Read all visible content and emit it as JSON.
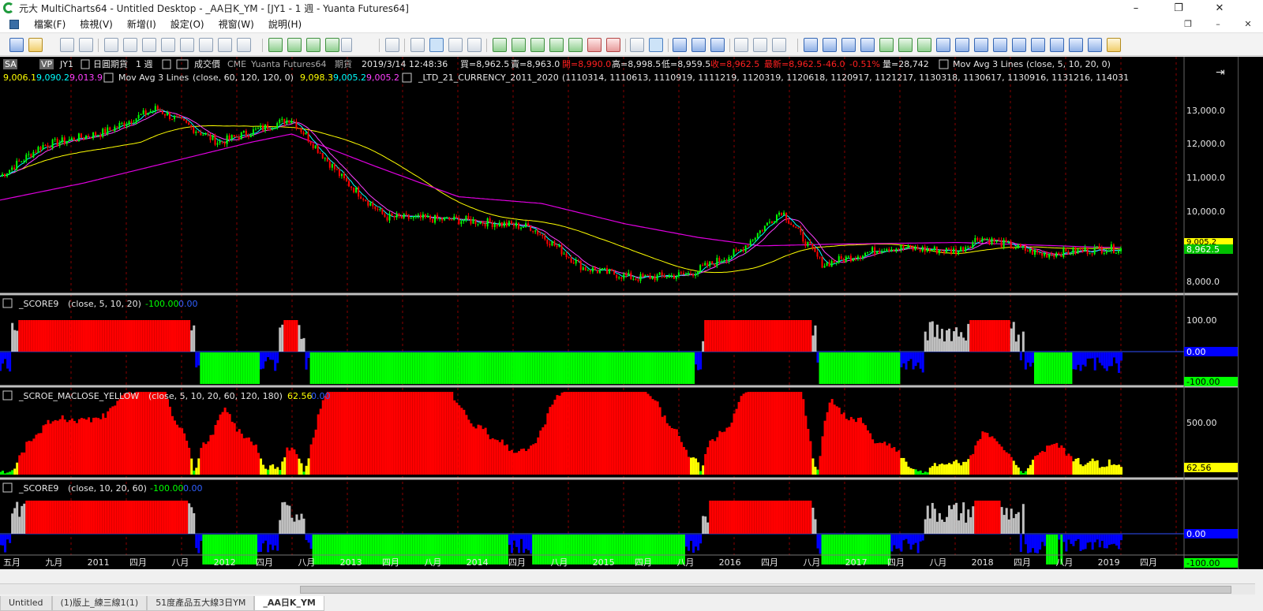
{
  "window": {
    "title": "元大 MultiCharts64 - Untitled Desktop - _AA日K_YM - [JY1 - 1 週 - Yuanta Futures64]",
    "controls": [
      "–",
      "❐",
      "✕"
    ]
  },
  "menu": {
    "items": [
      "檔案(F)",
      "檢視(V)",
      "新增(I)",
      "設定(O)",
      "視窗(W)",
      "說明(H)"
    ],
    "mdi_controls": [
      "❐",
      "–",
      "✕"
    ]
  },
  "chart_header": {
    "badge_sa": "SA",
    "badge_vp": "VP",
    "symbol": "JY1",
    "desc": "日圓期貨",
    "interval": "1 週",
    "price_type": "成交價",
    "exchange": "CME",
    "feed": "Yuanta Futures64",
    "kind": "期貨",
    "datetime": "2019/3/14  12:48:36",
    "bid": "買=8,962.5",
    "ask": "賣=8,963.0",
    "open": "開=8,990.0",
    "high": "高=8,998.5",
    "low": "低=8,959.5",
    "close": "收=8,962.5",
    "last": "最新=8,962.5",
    "change": "-46.0",
    "change_pct": "-0.51%",
    "volume": "量=28,742",
    "study1_name": "Mov Avg 3 Lines",
    "study1_params": "(close,  5,  10,  20,  0)",
    "study1_values": [
      "9,006.1",
      "9,090.2",
      "9,013.9"
    ],
    "study2_name": "Mov Avg 3 Lines",
    "study2_params": "(close,  60,  120,  120,  0)",
    "study2_values": [
      "9,098.3",
      "9,005.2",
      "9,005.2"
    ],
    "study3_name": "_LTD_21_CURRENCY_2011_2020",
    "study3_params": "(1110314,  1110613,  1110919,  1111219,  1120319,  1120618,  1120917,  1121217,  1130318,  1130617,  1130916,  1131216,  114031"
  },
  "sub1": {
    "name": "_SCORE9",
    "params": "(close,  5,  10,  20)",
    "v1": "-100.00",
    "v2": "0.00"
  },
  "sub2": {
    "name": "_SCROE_MACLOSE_YELLOW",
    "params": "(close,  5,  10,  20,  60,  120,  180)",
    "v1": "62.56",
    "v2": "0.00"
  },
  "sub3": {
    "name": "_SCORE9",
    "params": "(close,  10,  20,  60)",
    "v1": "-100.00",
    "v2": "0.00"
  },
  "price_axis": {
    "ticks": [
      "13,000.0",
      "12,000.0",
      "11,000.0",
      "10,000.0",
      "8,000.0"
    ],
    "last_tag": "8,962.5",
    "other_tag": "9,005.2"
  },
  "sub1_axis": {
    "ticks": [
      "100.00",
      "0.00",
      "-100.00"
    ]
  },
  "sub2_axis": {
    "ticks": [
      "500.00",
      "62.56"
    ]
  },
  "sub3_axis": {
    "ticks": [
      "0.00",
      "-100.00"
    ]
  },
  "time_axis": {
    "labels": [
      "五月",
      "九月",
      "2011",
      "四月",
      "八月",
      "2012",
      "四月",
      "八月",
      "2013",
      "四月",
      "八月",
      "2014",
      "四月",
      "八月",
      "2015",
      "四月",
      "八月",
      "2016",
      "四月",
      "八月",
      "2017",
      "四月",
      "八月",
      "2018",
      "四月",
      "八月",
      "2019",
      "四月"
    ]
  },
  "colors": {
    "up_candle": "#00ff00",
    "down_candle": "#ff0000",
    "ma_magenta": "#e000e0",
    "ma_yellow": "#ffff00",
    "ma_cyan": "#00ffff",
    "score_red": "#ff0000",
    "score_gray": "#c0c0c0",
    "score_blue": "#0000ff",
    "score_green": "#00ff00"
  },
  "sheet_tabs": [
    "Untitled",
    "(1)版上_練三線1(1)",
    "51度產品五大線3日YM",
    "_AA日K_YM"
  ],
  "chart_data": {
    "type": "line",
    "x_range": [
      "2010-05",
      "2019-04"
    ],
    "price_ylim": [
      8000,
      13000
    ],
    "price_series": [
      {
        "name": "Mov Avg 3 Lines",
        "color": "#e000e0",
        "x": [
          "2010-05",
          "2011-01",
          "2011-09",
          "2012-05",
          "2012-09",
          "2013-05",
          "2014-01",
          "2014-09",
          "2015-05",
          "2015-12",
          "2016-06",
          "2017-01",
          "2018-01",
          "2019-03"
        ],
        "values": [
          10400,
          10900,
          11500,
          12100,
          12350,
          11400,
          10500,
          10300,
          9700,
          9300,
          9050,
          9100,
          9150,
          9005
        ]
      },
      {
        "name": "close",
        "color": "#00ff00",
        "x": [
          "2010-05",
          "2010-09",
          "2011-03",
          "2011-08",
          "2012-02",
          "2012-09",
          "2013-02",
          "2013-06",
          "2014-02",
          "2014-08",
          "2015-01",
          "2015-06",
          "2015-11",
          "2016-04",
          "2016-08",
          "2016-12",
          "2017-06",
          "2018-01",
          "2018-03",
          "2018-09",
          "2019-03"
        ],
        "values": [
          11100,
          12000,
          12400,
          13100,
          12100,
          12800,
          11000,
          9900,
          9800,
          9600,
          8400,
          8100,
          8200,
          8900,
          10100,
          8500,
          9000,
          8900,
          9300,
          8800,
          8962.5
        ]
      }
    ],
    "sub2_ylim": [
      0,
      650
    ]
  }
}
